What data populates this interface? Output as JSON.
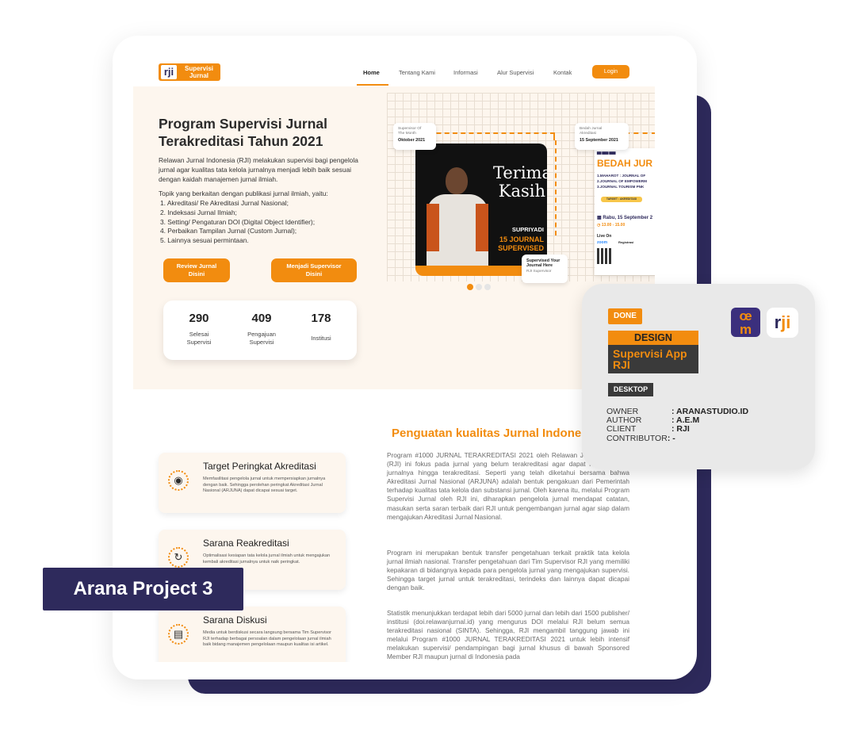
{
  "nav": {
    "logo_mark": "rji",
    "logo_text_1": "Supervisi",
    "logo_text_2": "Jurnal",
    "links": [
      "Home",
      "Tentang Kami",
      "Informasi",
      "Alur Supervisi",
      "Kontak"
    ],
    "login": "Login"
  },
  "hero": {
    "title_1": "Program Supervisi Jurnal",
    "title_2": "Terakreditasi Tahun 2021",
    "desc": "Relawan Jurnal Indonesia (RJI) melakukan supervisi bagi pengelola jurnal agar kualitas tata kelola jurnalnya menjadi lebih baik sesuai dengan kaidah manajemen jurnal ilmiah.",
    "topic_intro": "Topik yang berkaitan dengan publikasi jurnal ilmiah, yaitu:",
    "topics": [
      "1. Akreditasi/ Re Akreditasi Jurnal Nasional;",
      "2. Indeksasi Jurnal Ilmiah;",
      "3. Setting/ Pengaturan DOI (Digital Object Identifier);",
      "4. Perbaikan Tampilan Jurnal (Custom Jurnal);",
      "5. Lainnya sesuai permintaan."
    ],
    "btn_review_1": "Review Jurnal",
    "btn_review_2": "Disini",
    "btn_supervisor_1": "Menjadi Supervisor",
    "btn_supervisor_2": "Disini",
    "stats": [
      {
        "num": "290",
        "label_1": "Selesai",
        "label_2": "Supervisi"
      },
      {
        "num": "409",
        "label_1": "Pengajuan",
        "label_2": "Supervisi"
      },
      {
        "num": "178",
        "label_1": "Institusi",
        "label_2": ""
      }
    ]
  },
  "showcase": {
    "card1_small_1": "Supervisor Of",
    "card1_small_2": "The Month",
    "card1_bold": "Oktober 2021",
    "card2_small_1": "Bedah Jurnal",
    "card2_small_2": "Akreditasi",
    "card2_bold": "15 September 2021",
    "terima_1": "Terima",
    "terima_2": "Kasih",
    "name": "SUPRIYADI",
    "orange_1": "15 JOURNAL",
    "orange_2": "SUPERVISED",
    "card3_bold_1": "Supervised Your",
    "card3_bold_2": "Journal Here",
    "card3_small": "RJI Supervisor",
    "poster_title": "BEDAH JUR",
    "poster_lines": [
      "1.MAHAROT : JOURNAL OF",
      "2.JOURNAL OF EMPOWERM",
      "3.JOURNAL TOURISM PNK"
    ],
    "poster_tag": "TARGET : AKREDITASI",
    "poster_date": "Rabu, 15 September 2",
    "poster_time": "13.00 - 15.00",
    "poster_live": "Live On",
    "poster_zoom": "zoom",
    "poster_reg": "Registrasi"
  },
  "section2": {
    "title": "Penguatan kualitas Jurnal Indonesia",
    "features": [
      {
        "title": "Target Peringkat Akreditasi",
        "desc": "Memfasilitasi pengelola jurnal untuk mempersiapkan jurnalnya dengan baik. Sehingga perolehan peringkat Akreditasi Jurnal Nasional (ARJUNA) dapat dicapai sesuai target.",
        "icon": "◉"
      },
      {
        "title": "Sarana Reakreditasi",
        "desc": "Optimalisasi kesiapan tata kelola jurnal ilmiah untuk mengajukan kembali akreditasi jurnalnya untuk naik peringkat.",
        "icon": "↻"
      },
      {
        "title": "Sarana Diskusi",
        "desc": "Media untuk berdiskusi secara langsung bersama Tim Supervisor RJI terhadap berbagai persoalan dalam pengelolaan jurnal ilmiah baik bidang manajemen pengelolaan maupun kualitas isi artikel.",
        "icon": "▤"
      }
    ],
    "para1": "Program #1000 JURNAL TERAKREDITASI 2021 oleh Relawan Jurnal Indonesia (RJI) ini fokus pada jurnal yang belum terakreditasi agar dapat mendaftarkan jurnalnya hingga terakreditasi. Seperti yang telah diketahui bersama bahwa Akreditasi Jurnal Nasional (ARJUNA) adalah bentuk pengakuan dari Pemerintah terhadap kualitas tata kelola dan substansi jurnal. Oleh karena itu, melalui Program Supervisi Jurnal oleh RJI ini, diharapkan pengelola jurnal mendapat catatan, masukan serta saran terbaik dari RJI untuk pengembangan jurnal agar siap dalam mengajukan Akreditasi Jurnal Nasional.",
    "para2": "Program ini merupakan bentuk transfer pengetahuan terkait praktik tata kelola jurnal ilmiah nasional. Transfer pengetahuan dari Tim Supervisor RJI yang memiliki kepakaran di bidangnya kepada para pengelola jurnal yang mengajukan supervisi. Sehingga target jurnal untuk terakreditasi, terindeks dan lainnya dapat dicapai dengan baik.",
    "para3": "Statistik menunjukkan terdapat lebih dari 5000 jurnal dan lebih dari 1500 publisher/ institusi (doi.relawanjurnal.id) yang mengurus DOI melalui RJI belum semua terakreditasi nasional (SINTA). Sehingga, RJI mengambil tanggung jawab ini melalui Program #1000 JURNAL TERAKREDITASI 2021 untuk lebih intensif melakukan supervisi/ pendampingan bagi jurnal khusus di bawah Sponsored Member RJI maupun jurnal di Indonesia pada"
  },
  "info_card": {
    "status": "DONE",
    "design": "DESIGN",
    "app_1": "Supervisi App",
    "app_2": "RJI",
    "platform": "DESKTOP",
    "meta": [
      {
        "key": "OWNER",
        "val": ": ARANASTUDIO.ID"
      },
      {
        "key": "AUTHOR",
        "val": ": A.E.M"
      },
      {
        "key": "CLIENT",
        "val": ": RJI"
      },
      {
        "key": "CONTRIBUTOR",
        "val": ": -"
      }
    ],
    "logo_ae_1": "œ",
    "logo_ae_2": "m",
    "logo_rji_1": "r",
    "logo_rji_2": "ji"
  },
  "project_label": "Arana Project 3",
  "colors": {
    "accent": "#f28c0f",
    "navy": "#2e2a5c",
    "cream": "#fdf6ee"
  }
}
